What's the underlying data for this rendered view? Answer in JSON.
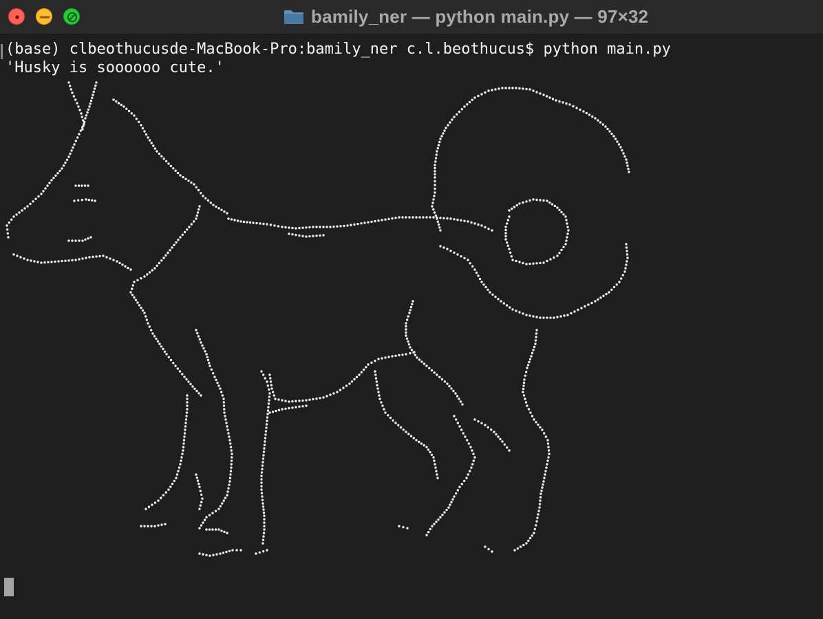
{
  "window": {
    "title": "bamily_ner — python main.py — 97×32",
    "folder_icon": "folder-icon",
    "colors": {
      "background": "#1e1e1e",
      "titlebar": "#2a2a2a",
      "text": "#f2f2f2",
      "close": "#fe5f57",
      "minimize": "#febc2e",
      "zoom": "#28c840"
    }
  },
  "terminal": {
    "command_line": "(base) clbeothucusde-MacBook-Pro:bamily_ner c.l.beothucus$ python main.py",
    "output_line": "'Husky is soooooo cute.'",
    "art_description_icon": "husky-dog-braille-art"
  }
}
